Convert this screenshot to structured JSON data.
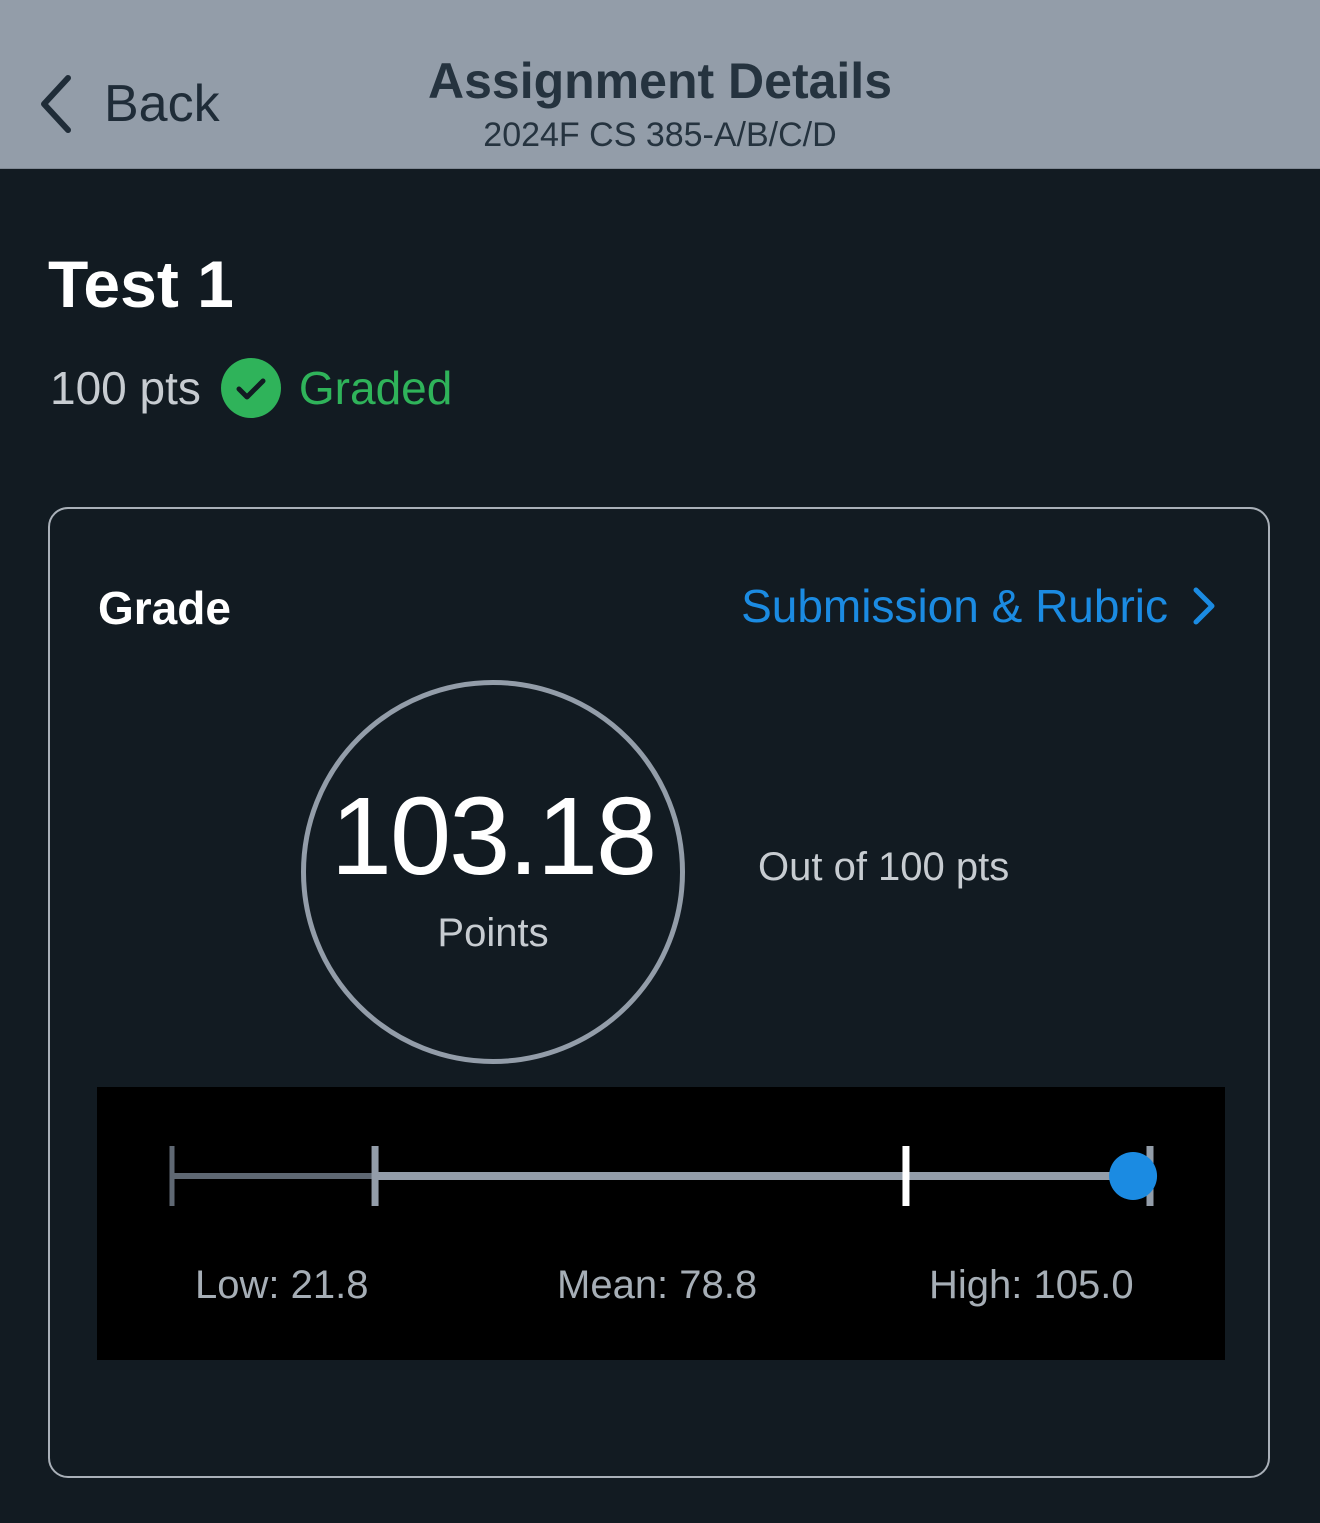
{
  "nav": {
    "back_label": "Back",
    "title": "Assignment Details",
    "subtitle": "2024F CS 385-A/B/C/D"
  },
  "assignment": {
    "title": "Test 1",
    "points_possible": "100 pts",
    "status": "Graded"
  },
  "grade": {
    "label": "Grade",
    "link_label": "Submission & Rubric",
    "score": "103.18",
    "score_unit": "Points",
    "out_of": "Out of 100 pts",
    "score_value": 103.18
  },
  "stats": {
    "low_label": "Low: 21.8",
    "mean_label": "Mean: 78.8",
    "high_label": "High: 105.0",
    "low": 21.8,
    "mean": 78.8,
    "high": 105.0,
    "min": 0
  },
  "colors": {
    "nav_bg": "#939da9",
    "page_bg": "#121b22",
    "accent": "#1b8be2",
    "graded": "#2fb35a"
  },
  "icons": {
    "back": "chevron-left-icon",
    "graded": "check-circle-icon",
    "link": "chevron-right-icon"
  }
}
